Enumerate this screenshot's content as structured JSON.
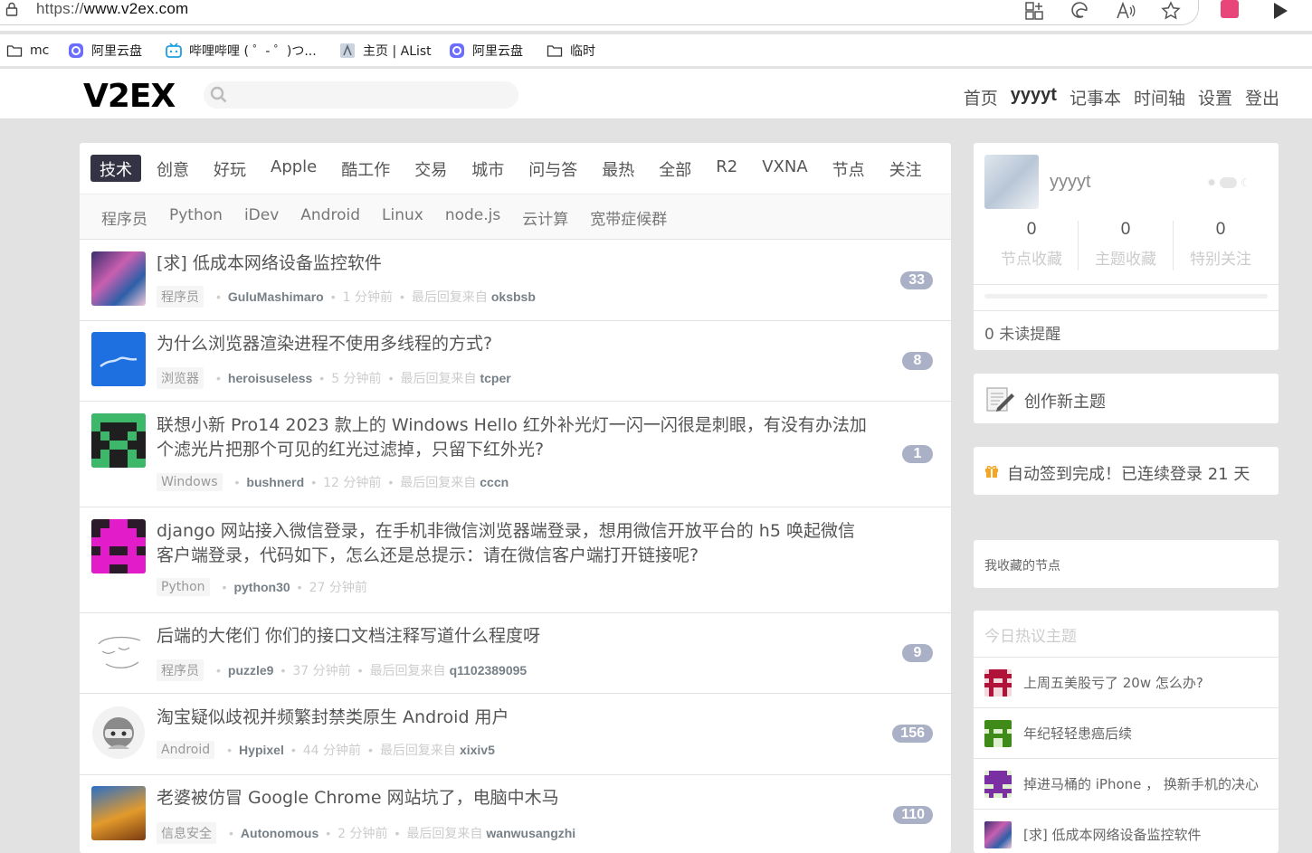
{
  "browser": {
    "url_prefix": "https://",
    "url_host": "www.v2ex.com",
    "bookmarks": [
      {
        "label": "mc",
        "icon": "folder-icon"
      },
      {
        "label": "阿里云盘",
        "icon": "aliyun-icon"
      },
      {
        "label": "哔哩哔哩 ( ゜- ゜)つ...",
        "icon": "bilibili-icon"
      },
      {
        "label": "主页 | AList",
        "icon": "alist-icon"
      },
      {
        "label": "阿里云盘",
        "icon": "aliyun-icon"
      },
      {
        "label": "临时",
        "icon": "folder-icon"
      }
    ]
  },
  "header": {
    "logo": "V2EX",
    "nav": [
      "首页",
      "yyyyt",
      "记事本",
      "时间轴",
      "设置",
      "登出"
    ]
  },
  "tabs": [
    "技术",
    "创意",
    "好玩",
    "Apple",
    "酷工作",
    "交易",
    "城市",
    "问与答",
    "最热",
    "全部",
    "R2",
    "VXNA",
    "节点",
    "关注"
  ],
  "active_tab": "技术",
  "subtabs": [
    "程序员",
    "Python",
    "iDev",
    "Android",
    "Linux",
    "node.js",
    "云计算",
    "宽带症候群"
  ],
  "topics": [
    {
      "title": "[求] 低成本网络设备监控软件",
      "node": "程序员",
      "author": "GuluMashimaro",
      "time": "1 分钟前",
      "last_label": "最后回复来自",
      "last_user": "oksbsb",
      "replies": "33"
    },
    {
      "title": "为什么浏览器渲染进程不使用多线程的方式?",
      "node": "浏览器",
      "author": "heroisuseless",
      "time": "5 分钟前",
      "last_label": "最后回复来自",
      "last_user": "tcper",
      "replies": "8"
    },
    {
      "title": "联想小新 Pro14 2023 款上的 Windows Hello 红外补光灯一闪一闪很是刺眼，有没有办法加个滤光片把那个可见的红光过滤掉，只留下红外光?",
      "node": "Windows",
      "author": "bushnerd",
      "time": "12 分钟前",
      "last_label": "最后回复来自",
      "last_user": "cccn",
      "replies": "1"
    },
    {
      "title": "django 网站接入微信登录，在手机非微信浏览器端登录，想用微信开放平台的 h5 唤起微信客户端登录，代码如下，怎么还是总提示：请在微信客户端打开链接呢?",
      "node": "Python",
      "author": "python30",
      "time": "27 分钟前",
      "last_label": "",
      "last_user": "",
      "replies": ""
    },
    {
      "title": "后端的大佬们 你们的接口文档注释写道什么程度呀",
      "node": "程序员",
      "author": "puzzle9",
      "time": "37 分钟前",
      "last_label": "最后回复来自",
      "last_user": "q1102389095",
      "replies": "9"
    },
    {
      "title": "淘宝疑似歧视并频繁封禁类原生 Android 用户",
      "node": "Android",
      "author": "Hypixel",
      "time": "44 分钟前",
      "last_label": "最后回复来自",
      "last_user": "xixiv5",
      "replies": "156"
    },
    {
      "title": "老婆被仿冒 Google Chrome 网站坑了，电脑中木马",
      "node": "信息安全",
      "author": "Autonomous",
      "time": "2 分钟前",
      "last_label": "最后回复来自",
      "last_user": "wanwusangzhi",
      "replies": "110"
    }
  ],
  "sidebar": {
    "username": "yyyyt",
    "stats": [
      {
        "value": "0",
        "label": "节点收藏"
      },
      {
        "value": "0",
        "label": "主题收藏"
      },
      {
        "value": "0",
        "label": "特别关注"
      }
    ],
    "unread": "0 未读提醒",
    "new_topic": "创作新主题",
    "checkin": "自动签到完成！已连续登录 21 天",
    "fav_nodes": "我收藏的节点",
    "hot_title": "今日热议主题",
    "hot": [
      "上周五美股亏了 20w 怎么办?",
      "年纪轻轻患癌后续",
      "掉进马桶的 iPhone ， 换新手机的决心",
      "[求] 低成本网络设备监控软件"
    ]
  },
  "colors": {
    "accent": "#334455",
    "count_badge": "#aab0c6",
    "bg": "#e2e2e2"
  }
}
